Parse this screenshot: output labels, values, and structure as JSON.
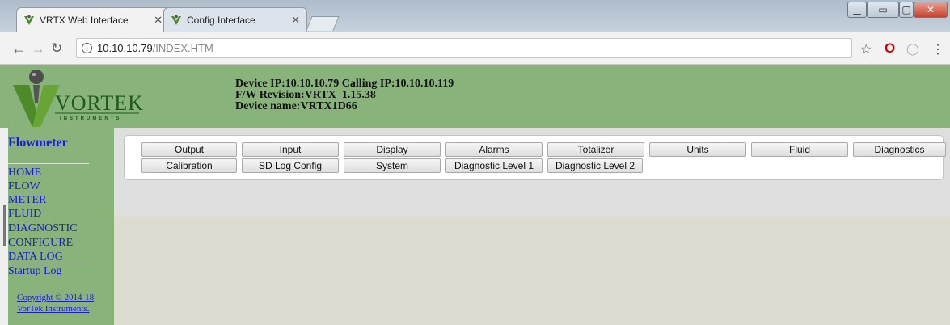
{
  "browser": {
    "tabs": [
      {
        "title": "VRTX Web Interface",
        "active": true
      },
      {
        "title": "Config Interface",
        "active": false
      }
    ],
    "url_host": "10.10.10.79",
    "url_path": "/INDEX.HTM",
    "colors": {
      "titlebar": "#c7d2dd",
      "tab_active": "#f2f2f2",
      "opera": "#d40000"
    }
  },
  "header": {
    "logo_text": "VORTEK",
    "logo_subtext": "INSTRUMENTS",
    "device_ip_line": "Device IP:10.10.10.79 Calling IP:10.10.10.119",
    "firmware_line": "F/W Revision:VRTX_1.15.38",
    "device_name_line": "Device name:VRTX1D66"
  },
  "sidebar": {
    "title": "Flowmeter",
    "items": [
      {
        "label": "HOME"
      },
      {
        "label": "FLOW"
      },
      {
        "label": "METER"
      },
      {
        "label": "FLUID"
      },
      {
        "label": "DIAGNOSTIC"
      },
      {
        "label": "CONFIGURE"
      },
      {
        "label": "DATA LOG"
      },
      {
        "label": "Startup Log"
      }
    ],
    "copyright_line1": "Copyright © 2014-18",
    "copyright_line2": "VorTek Instruments."
  },
  "menu": {
    "row1": [
      "Output",
      "Input",
      "Display",
      "Alarms",
      "Totalizer",
      "Units",
      "Fluid",
      "Diagnostics"
    ],
    "row2": [
      "Calibration",
      "SD Log Config",
      "System",
      "Diagnostic Level 1",
      "Diagnostic Level 2"
    ]
  },
  "theme": {
    "accent_green": "#88b47c",
    "link_blue": "#1c1ccf"
  }
}
